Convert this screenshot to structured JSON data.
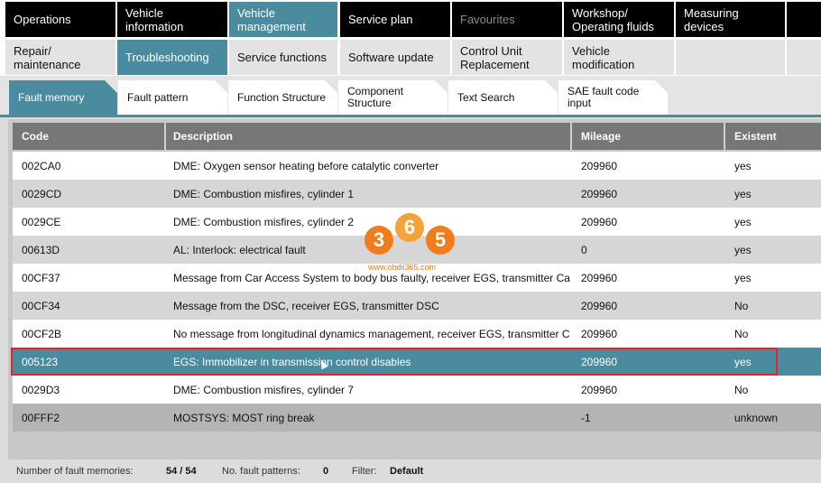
{
  "top_tabs": [
    {
      "label": "Operations"
    },
    {
      "label": "Vehicle information"
    },
    {
      "label": "Vehicle management"
    },
    {
      "label": "Service plan"
    },
    {
      "label": "Favourites"
    },
    {
      "label": "Workshop/ Operating fluids"
    },
    {
      "label": "Measuring devices"
    }
  ],
  "sub_tabs": [
    {
      "label": "Repair/ maintenance"
    },
    {
      "label": "Troubleshooting"
    },
    {
      "label": "Service functions"
    },
    {
      "label": "Software update"
    },
    {
      "label": "Control Unit Replacement"
    },
    {
      "label": "Vehicle modification"
    }
  ],
  "folder_tabs": [
    {
      "label": "Fault memory"
    },
    {
      "label": "Fault pattern"
    },
    {
      "label": "Function Structure"
    },
    {
      "label": "Component Structure"
    },
    {
      "label": "Text Search"
    },
    {
      "label": "SAE fault code input"
    }
  ],
  "table": {
    "headers": [
      "Code",
      "Description",
      "Mileage",
      "Existent"
    ],
    "rows": [
      {
        "code": "002CA0",
        "description": "DME: Oxygen sensor heating before catalytic converter",
        "mileage": "209960",
        "existent": "yes"
      },
      {
        "code": "0029CD",
        "description": "DME: Combustion misfires, cylinder 1",
        "mileage": "209960",
        "existent": "yes"
      },
      {
        "code": "0029CE",
        "description": "DME: Combustion misfires, cylinder 2",
        "mileage": "209960",
        "existent": "yes"
      },
      {
        "code": "00613D",
        "description": "AL: Interlock: electrical fault",
        "mileage": "0",
        "existent": "yes"
      },
      {
        "code": "00CF37",
        "description": "Message from Car Access System to body bus faulty, receiver EGS, transmitter Ca",
        "mileage": "209960",
        "existent": "yes"
      },
      {
        "code": "00CF34",
        "description": "Message from the DSC, receiver EGS, transmitter DSC",
        "mileage": "209960",
        "existent": "No"
      },
      {
        "code": "00CF2B",
        "description": "No message from longitudinal dynamics management, receiver EGS, transmitter C",
        "mileage": "209960",
        "existent": "No"
      },
      {
        "code": "005123",
        "description": "EGS: Immobilizer in transmission control disables",
        "mileage": "209960",
        "existent": "yes"
      },
      {
        "code": "0029D3",
        "description": "DME: Combustion misfires, cylinder 7",
        "mileage": "209960",
        "existent": "No"
      },
      {
        "code": "00FFF2",
        "description": "MOSTSYS: MOST ring break",
        "mileage": "-1",
        "existent": "unknown"
      }
    ]
  },
  "status": {
    "fault_memories_label": "Number of fault memories:",
    "fault_memories_value": "54 / 54",
    "fault_patterns_label": "No. fault patterns:",
    "fault_patterns_value": "0",
    "filter_label": "Filter:",
    "filter_value": "Default"
  },
  "watermark": {
    "digit1": "3",
    "digit2": "6",
    "digit3": "5",
    "url": "www.obdii365.com"
  },
  "colors": {
    "accent": "#4b8ba0",
    "selection_border": "#e0262b",
    "watermark": "#f07c1b"
  }
}
